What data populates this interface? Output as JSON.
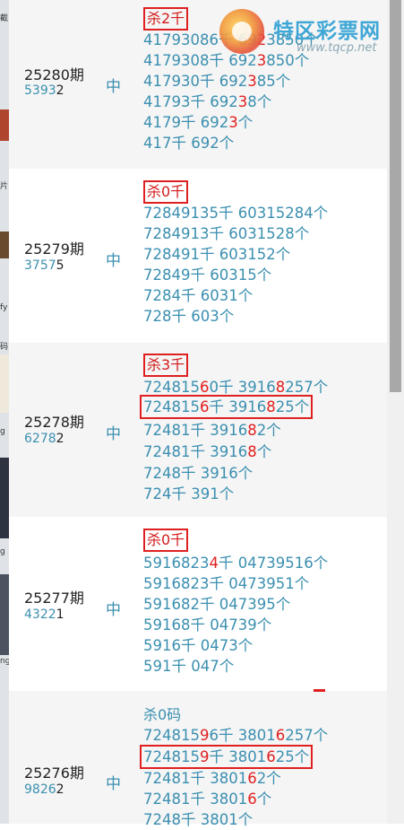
{
  "brand": {
    "name": "特区彩票网",
    "url": "www.tqcp.net"
  },
  "left_fragments": [
    "截",
    "片",
    "fy",
    "码",
    "g",
    "g",
    "ng"
  ],
  "rows": [
    {
      "period": "25280期",
      "code_main": "5393",
      "code_last": "2",
      "hit": "中",
      "kill": "杀2千",
      "kill_boxed": true,
      "lines": [
        {
          "pre": "41793086千 69",
          "red": "2",
          "post": "3850个"
        },
        {
          "pre": "4179308千 692",
          "red": "3",
          "post": "850个"
        },
        {
          "pre": "417930千 692",
          "red": "3",
          "post": "85个"
        },
        {
          "pre": "41793千 692",
          "red": "3",
          "post": "8个"
        },
        {
          "pre": "4179千 692",
          "red": "3",
          "post": "个"
        },
        {
          "pre": "417千 692个",
          "red": "",
          "post": ""
        }
      ]
    },
    {
      "period": "25279期",
      "code_main": "3757",
      "code_last": "5",
      "hit": "中",
      "kill": "杀0千",
      "kill_boxed": true,
      "lines": [
        {
          "pre": "72849135千 60315284个",
          "red": "",
          "post": ""
        },
        {
          "pre": "7284913千 6031528个",
          "red": "",
          "post": ""
        },
        {
          "pre": "728491千 603152个",
          "red": "",
          "post": ""
        },
        {
          "pre": "72849千 60315个",
          "red": "",
          "post": ""
        },
        {
          "pre": "7284千 6031个",
          "red": "",
          "post": ""
        },
        {
          "pre": "728千 603个",
          "red": "",
          "post": ""
        }
      ]
    },
    {
      "period": "25278期",
      "code_main": "6278",
      "code_last": "2",
      "hit": "中",
      "kill": "杀3千",
      "kill_boxed": true,
      "lines": [
        {
          "pre": "724815",
          "red": "6",
          "post": "0千 3916",
          "red2": "8",
          "post2": "257个"
        },
        {
          "pre": "724815",
          "red": "6",
          "post": "千 3916",
          "red2": "8",
          "post2": "25个",
          "boxed": true
        },
        {
          "pre": "72481千 3916",
          "red": "8",
          "post": "2个"
        },
        {
          "pre": "72481千 3916",
          "red": "8",
          "post": "个"
        },
        {
          "pre": "7248千 3916个",
          "red": "",
          "post": ""
        },
        {
          "pre": "724千 391个",
          "red": "",
          "post": ""
        }
      ]
    },
    {
      "period": "25277期",
      "code_main": "4322",
      "code_last": "1",
      "hit": "中",
      "kill": "杀0千",
      "kill_boxed": true,
      "lines": [
        {
          "pre": "5916823",
          "red": "4",
          "post": "千 04739516个"
        },
        {
          "pre": "5916823千 0473951个",
          "red": "",
          "post": ""
        },
        {
          "pre": "591682千 047395个",
          "red": "",
          "post": ""
        },
        {
          "pre": "59168千 04739个",
          "red": "",
          "post": ""
        },
        {
          "pre": "5916千 0473个",
          "red": "",
          "post": ""
        },
        {
          "pre": "591千 047个",
          "red": "",
          "post": ""
        }
      ]
    },
    {
      "period": "25276期",
      "code_main": "9826",
      "code_last": "2",
      "hit": "中",
      "kill": "杀0码",
      "kill_boxed": false,
      "lines": [
        {
          "pre": "724815",
          "red": "9",
          "post": "6千 3801",
          "red2": "6",
          "post2": "257个"
        },
        {
          "pre": "724815",
          "red": "9",
          "post": "千 3801",
          "red2": "6",
          "post2": "25个",
          "boxed": true
        },
        {
          "pre": "72481千 3801",
          "red": "6",
          "post": "2个"
        },
        {
          "pre": "72481千 3801",
          "red": "6",
          "post": "个"
        },
        {
          "pre": "7248千 3801个",
          "red": "",
          "post": ""
        }
      ]
    }
  ]
}
